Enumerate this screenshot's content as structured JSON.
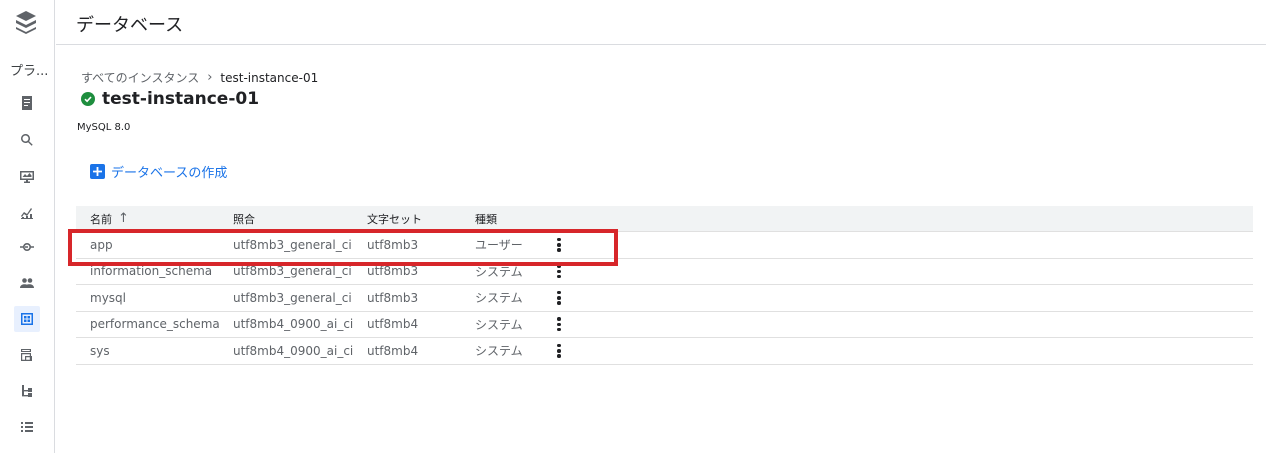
{
  "rail": {
    "title": "プラ...",
    "items": [
      {
        "icon": "document-icon",
        "active": false
      },
      {
        "icon": "search-icon",
        "active": false
      },
      {
        "icon": "monitor-icon",
        "active": false
      },
      {
        "icon": "chart-icon",
        "active": false
      },
      {
        "icon": "connection-icon",
        "active": false
      },
      {
        "icon": "users-icon",
        "active": false
      },
      {
        "icon": "database-grid-icon",
        "active": true
      },
      {
        "icon": "backup-icon",
        "active": false
      },
      {
        "icon": "hierarchy-icon",
        "active": false
      },
      {
        "icon": "list-icon",
        "active": false
      }
    ]
  },
  "header": {
    "title": "データベース"
  },
  "breadcrumb": {
    "parent": "すべてのインスタンス",
    "current": "test-instance-01"
  },
  "instance": {
    "name": "test-instance-01",
    "status": "running",
    "version": "MySQL 8.0"
  },
  "actions": {
    "create_database": "データベースの作成"
  },
  "table": {
    "columns": {
      "name": "名前",
      "collation": "照合",
      "charset": "文字セット",
      "type": "種類"
    },
    "rows": [
      {
        "name": "app",
        "collation": "utf8mb3_general_ci",
        "charset": "utf8mb3",
        "type": "ユーザー"
      },
      {
        "name": "information_schema",
        "collation": "utf8mb3_general_ci",
        "charset": "utf8mb3",
        "type": "システム"
      },
      {
        "name": "mysql",
        "collation": "utf8mb3_general_ci",
        "charset": "utf8mb3",
        "type": "システム"
      },
      {
        "name": "performance_schema",
        "collation": "utf8mb4_0900_ai_ci",
        "charset": "utf8mb4",
        "type": "システム"
      },
      {
        "name": "sys",
        "collation": "utf8mb4_0900_ai_ci",
        "charset": "utf8mb4",
        "type": "システム"
      }
    ]
  },
  "colors": {
    "accent": "#1a73e8",
    "status_ok": "#1e8e3e",
    "highlight": "#d7262a"
  }
}
